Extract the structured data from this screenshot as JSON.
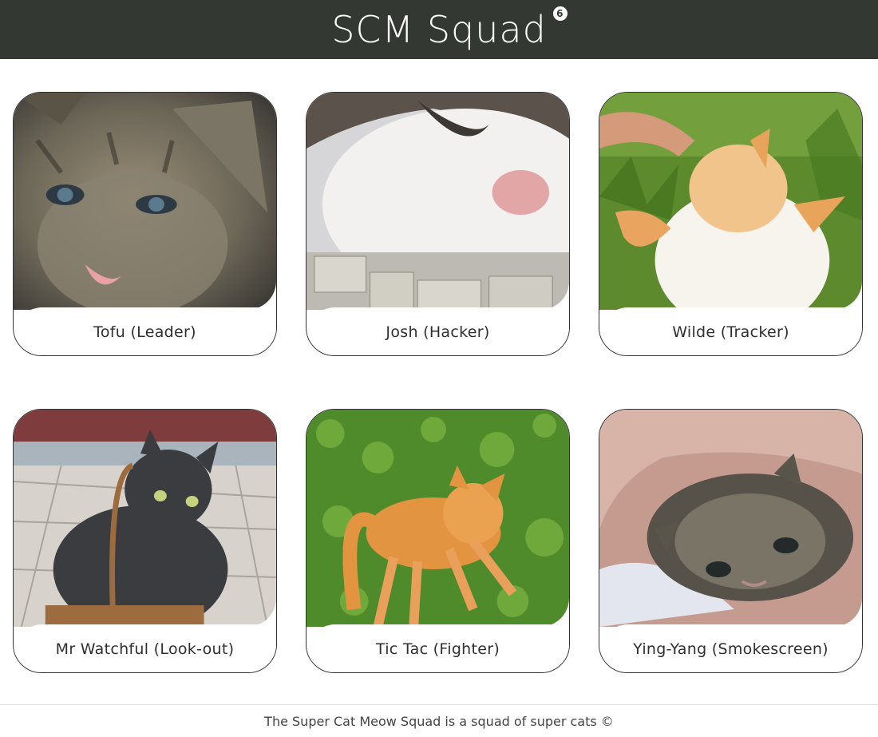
{
  "header": {
    "title": "SCM Squad",
    "count": "6"
  },
  "cards": [
    {
      "name": "Tofu (Leader)"
    },
    {
      "name": "Josh (Hacker)"
    },
    {
      "name": "Wilde (Tracker)"
    },
    {
      "name": "Mr Watchful (Look-out)"
    },
    {
      "name": "Tic Tac (Fighter)"
    },
    {
      "name": "Ying-Yang (Smokescreen)"
    }
  ],
  "footer": {
    "text": "The Super Cat Meow Squad is a squad of super cats ©"
  },
  "colors": {
    "header_bg": "#343833",
    "card_border": "#333333"
  }
}
